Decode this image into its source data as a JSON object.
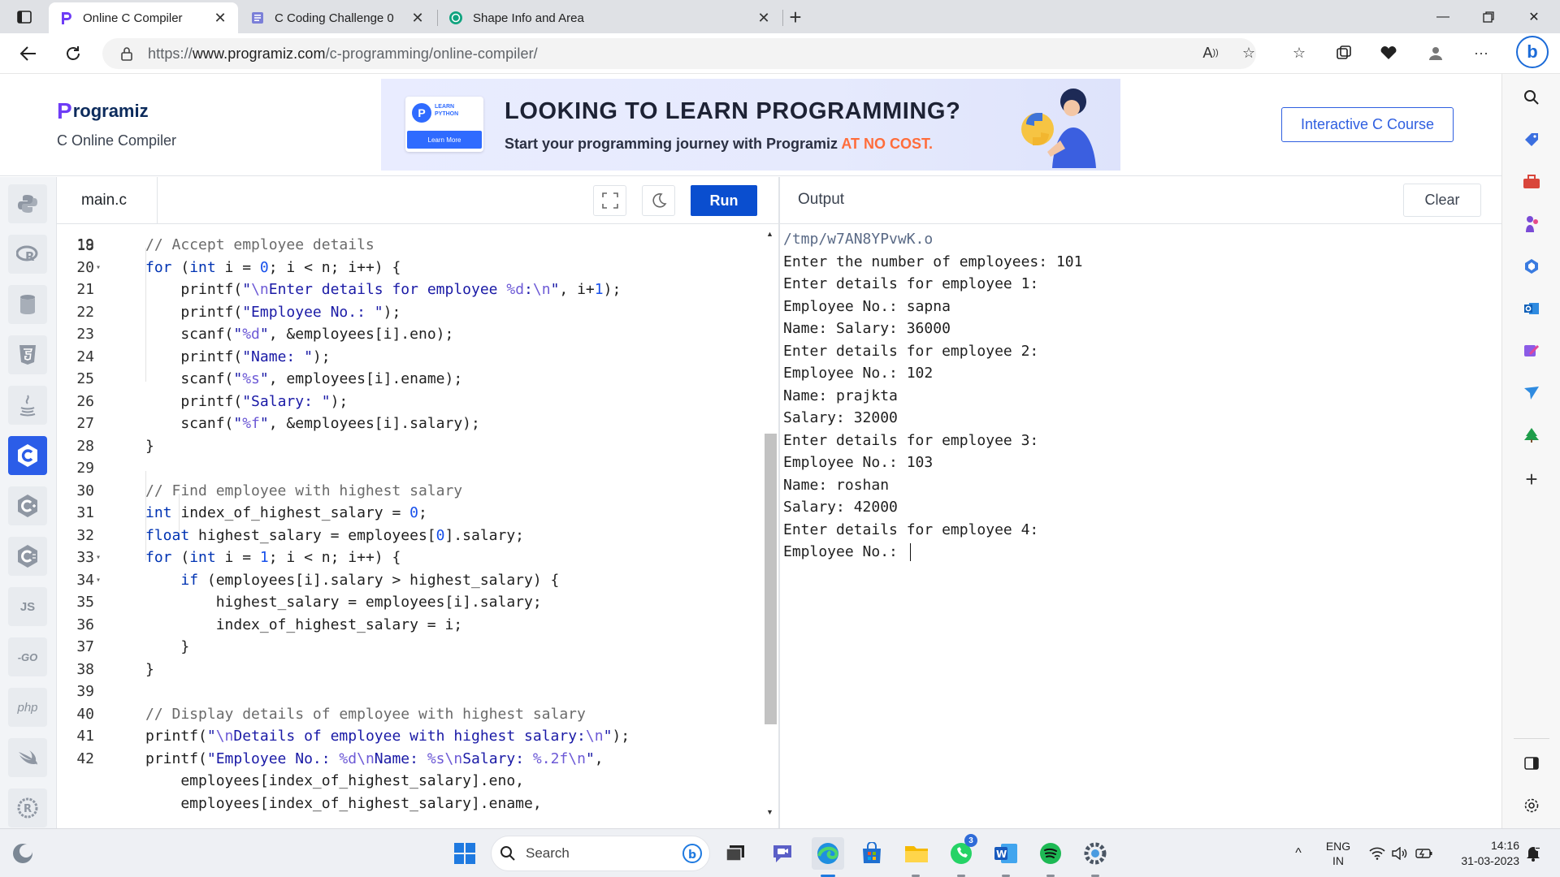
{
  "browser": {
    "tabs": [
      {
        "title": "Online C Compiler",
        "active": true,
        "favicon": "programiz-icon"
      },
      {
        "title": "C Coding Challenge 0",
        "active": false,
        "favicon": "forms-icon"
      },
      {
        "title": "Shape Info and Area",
        "active": false,
        "favicon": "chatgpt-icon"
      }
    ],
    "url_prefix": "https://",
    "url_host": "www.programiz.com",
    "url_path": "/c-programming/online-compiler/"
  },
  "header": {
    "logo_text": "rogramiz",
    "logo_initial": "P",
    "subtitle": "C Online Compiler",
    "ad": {
      "badge_line": "LEARN PYTHON",
      "badge_button": "Learn More",
      "headline": "LOOKING TO LEARN PROGRAMMING?",
      "sub_prefix": "Start your programming journey with Programiz ",
      "sub_highlight": "AT NO COST."
    },
    "course_button": "Interactive C Course"
  },
  "languages": [
    {
      "name": "python",
      "label": "Py",
      "icon": "python-icon"
    },
    {
      "name": "r",
      "label": "R",
      "icon": "r-icon"
    },
    {
      "name": "sql",
      "label": "SQL",
      "icon": "database-icon"
    },
    {
      "name": "html",
      "label": "5",
      "icon": "html5-icon"
    },
    {
      "name": "java",
      "label": "☕",
      "icon": "java-icon"
    },
    {
      "name": "c",
      "label": "C",
      "icon": "c-icon",
      "active": true
    },
    {
      "name": "cpp",
      "label": "C",
      "icon": "cpp-icon"
    },
    {
      "name": "csharp",
      "label": "C",
      "icon": "csharp-icon"
    },
    {
      "name": "js",
      "label": "JS",
      "icon": "javascript-icon"
    },
    {
      "name": "go",
      "label": "GO",
      "icon": "go-icon"
    },
    {
      "name": "php",
      "label": "php",
      "icon": "php-icon"
    },
    {
      "name": "swift",
      "label": "➶",
      "icon": "swift-icon"
    },
    {
      "name": "rust",
      "label": "R",
      "icon": "rust-icon"
    }
  ],
  "editor": {
    "file_name": "main.c",
    "run_label": "Run",
    "first_partial_line": "18",
    "lines": [
      {
        "n": "19",
        "fold": false,
        "html": "<span class=\"c\">// Accept employee details</span>"
      },
      {
        "n": "20",
        "fold": true,
        "html": "<span class=\"k\">for</span> (<span class=\"k\">int</span> i = <span class=\"n\">0</span>; i &lt; n; i++) {"
      },
      {
        "n": "21",
        "fold": false,
        "html": "    printf(<span class=\"s\">\"<span class=\"esc\">\\n</span>Enter details for employee <span class=\"esc\">%d</span>:<span class=\"esc\">\\n</span>\"</span>, i+<span class=\"n\">1</span>);"
      },
      {
        "n": "22",
        "fold": false,
        "html": "    printf(<span class=\"s\">\"Employee No.: \"</span>);"
      },
      {
        "n": "23",
        "fold": false,
        "html": "    scanf(<span class=\"s\">\"<span class=\"esc\">%d</span>\"</span>, &amp;employees[i].eno);"
      },
      {
        "n": "24",
        "fold": false,
        "html": "    printf(<span class=\"s\">\"Name: \"</span>);"
      },
      {
        "n": "25",
        "fold": false,
        "html": "    scanf(<span class=\"s\">\"<span class=\"esc\">%s</span>\"</span>, employees[i].ename);"
      },
      {
        "n": "26",
        "fold": false,
        "html": "    printf(<span class=\"s\">\"Salary: \"</span>);"
      },
      {
        "n": "27",
        "fold": false,
        "html": "    scanf(<span class=\"s\">\"<span class=\"esc\">%f</span>\"</span>, &amp;employees[i].salary);"
      },
      {
        "n": "28",
        "fold": false,
        "html": "}"
      },
      {
        "n": "29",
        "fold": false,
        "html": ""
      },
      {
        "n": "30",
        "fold": false,
        "html": "<span class=\"c\">// Find employee with highest salary</span>"
      },
      {
        "n": "31",
        "fold": false,
        "html": "<span class=\"k\">int</span> index_of_highest_salary = <span class=\"n\">0</span>;"
      },
      {
        "n": "32",
        "fold": false,
        "html": "<span class=\"k\">float</span> highest_salary = employees[<span class=\"n\">0</span>].salary;"
      },
      {
        "n": "33",
        "fold": true,
        "html": "<span class=\"k\">for</span> (<span class=\"k\">int</span> i = <span class=\"n\">1</span>; i &lt; n; i++) {"
      },
      {
        "n": "34",
        "fold": true,
        "html": "    <span class=\"k\">if</span> (employees[i].salary &gt; highest_salary) {"
      },
      {
        "n": "35",
        "fold": false,
        "html": "        highest_salary = employees[i].salary;"
      },
      {
        "n": "36",
        "fold": false,
        "html": "        index_of_highest_salary = i;"
      },
      {
        "n": "37",
        "fold": false,
        "html": "    }"
      },
      {
        "n": "38",
        "fold": false,
        "html": "}"
      },
      {
        "n": "39",
        "fold": false,
        "html": ""
      },
      {
        "n": "40",
        "fold": false,
        "html": "<span class=\"c\">// Display details of employee with highest salary</span>"
      },
      {
        "n": "41",
        "fold": false,
        "html": "printf(<span class=\"s\">\"<span class=\"esc\">\\n</span>Details of employee with highest salary:<span class=\"esc\">\\n</span>\"</span>);"
      },
      {
        "n": "42",
        "fold": false,
        "html": "printf(<span class=\"s\">\"Employee No.: <span class=\"esc\">%d</span><span class=\"esc\">\\n</span>Name: <span class=\"esc\">%s</span><span class=\"esc\">\\n</span>Salary: <span class=\"esc\">%.2f</span><span class=\"esc\">\\n</span>\"</span>,"
      },
      {
        "n": "",
        "fold": false,
        "html": "    employees[index_of_highest_salary].eno,"
      },
      {
        "n": "",
        "fold": false,
        "html": "    employees[index_of_highest_salary].ename,"
      }
    ]
  },
  "output": {
    "title": "Output",
    "clear_label": "Clear",
    "lines": [
      "/tmp/w7AN8YPvwK.o",
      "Enter the number of employees: 101",
      "Enter details for employee 1:",
      "Employee No.: sapna",
      "Name: Salary: 36000",
      "Enter details for employee 2:",
      "Employee No.: 102",
      "Name: prajkta",
      "Salary: 32000",
      "Enter details for employee 3:",
      "Employee No.: 103",
      "Name: roshan",
      "Salary: 42000",
      "Enter details for employee 4:",
      "Employee No.: "
    ]
  },
  "taskbar": {
    "search_label": "Search",
    "whatsapp_badge": "3",
    "lang_line1": "ENG",
    "lang_line2": "IN",
    "time": "14:16",
    "date": "31-03-2023"
  },
  "colors": {
    "accent": "#0a4ecf",
    "brand_purple": "#6e3cf6",
    "ad_highlight": "#ff6d3b"
  }
}
